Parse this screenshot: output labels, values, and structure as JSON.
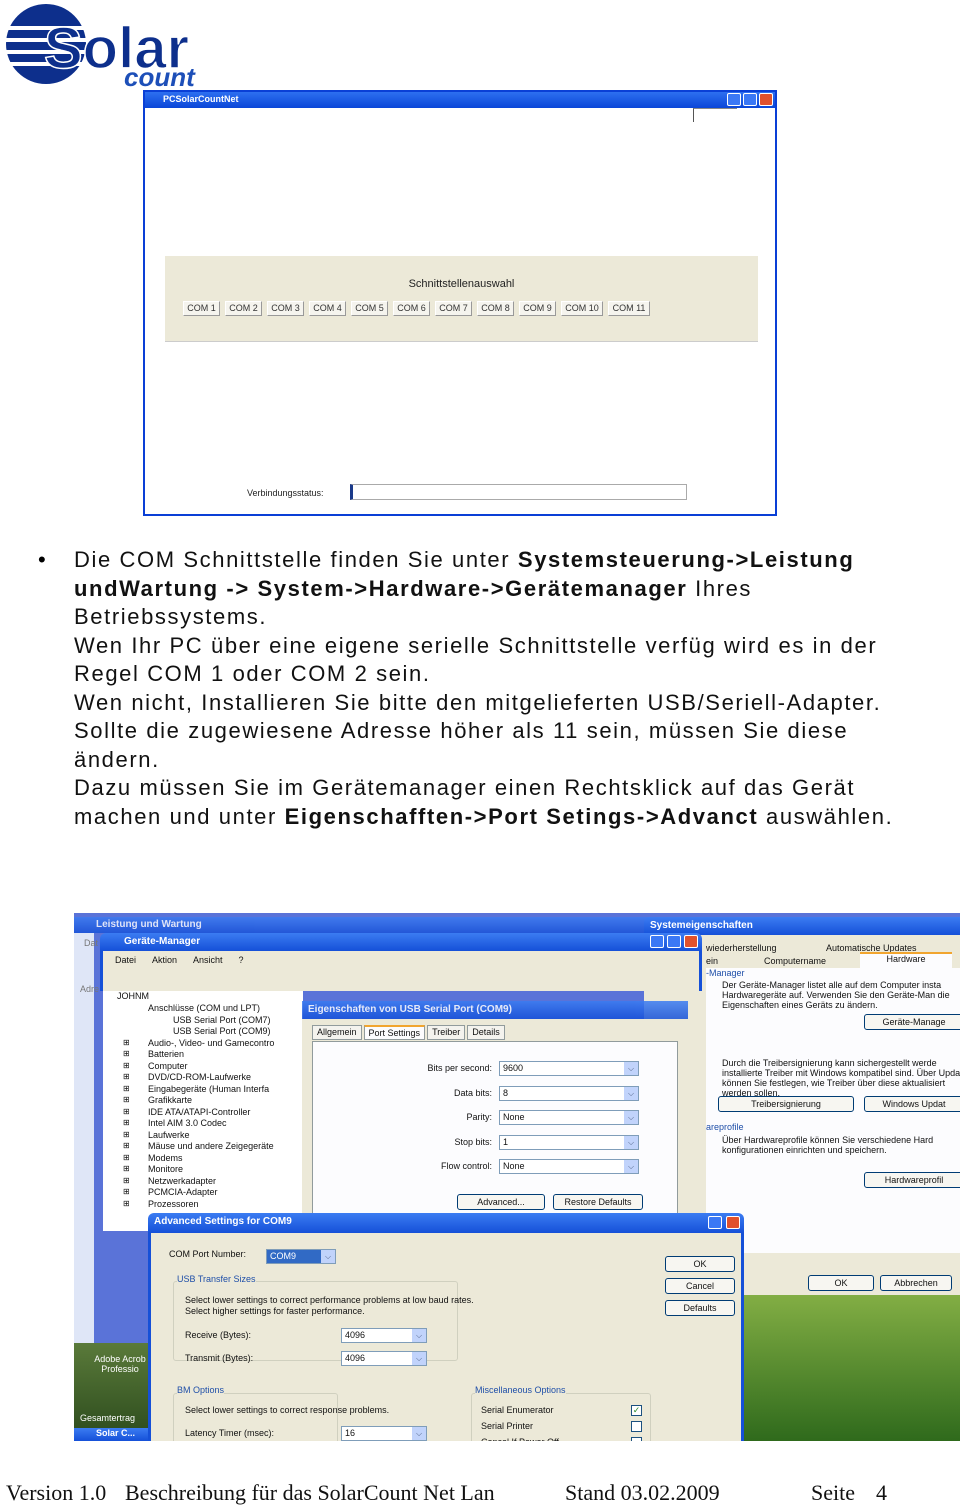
{
  "logo": {
    "text_main": "Solar",
    "text_sub": "count",
    "colors": {
      "blue": "#0d2f8c"
    }
  },
  "app_window": {
    "title": "PCSolarCountNet",
    "panel_title": "Schnittstellenauswahl",
    "com_buttons": [
      "COM 1",
      "COM 2",
      "COM 3",
      "COM 4",
      "COM 5",
      "COM 6",
      "COM 7",
      "COM 8",
      "COM 9",
      "COM 10",
      "COM 11"
    ],
    "status_label": "Verbindungsstatus:",
    "status_value": ""
  },
  "body": {
    "p1_a": "Die COM Schnittstelle finden Sie unter ",
    "p1_b": "Systemsteuerung->Leistung undWartung -> System->Hardware->Gerätemanager",
    "p1_c": " Ihres Betriebssystems.",
    "p2": "Wen Ihr PC über eine eigene serielle Schnittstelle verfüg wird es in der Regel COM 1 oder COM 2 sein.",
    "p3": "Wen nicht, Installieren Sie bitte den mitgelieferten USB/Seriell-Adapter.",
    "p4": "Sollte die zugewiesene Adresse höher als 11 sein, müssen Sie diese ändern.",
    "p5_a": "Dazu müssen Sie im Gerätemanager einen Rechtsklick auf das Gerät machen und unter ",
    "p5_b": "Eigenschafften->Port Setings->Advanct",
    "p5_c": " auswählen."
  },
  "screenshot": {
    "bg_window_title": "Leistung und Wartung",
    "sys_title": "Systemeigenschaften",
    "sys_tabs_row1": [
      "wiederherstellung",
      "Automatische Updates"
    ],
    "sys_tabs_row2": [
      "ein",
      "Computername",
      "Hardware"
    ],
    "sys_group1": "-Manager",
    "sys_text1": "Der Geräte-Manager listet alle auf dem Computer insta Hardwaregeräte auf. Verwenden Sie den Geräte-Man die Eigenschaften eines Geräts zu ändern.",
    "sys_btn1": "Geräte-Manage",
    "sys_text2": "Durch die Treibersignierung kann sichergestellt werde installierte Treiber mit Windows kompatibel sind. Über Update können Sie festlegen, wie Treiber über diese aktualisiert werden sollen.",
    "sys_btn2": "Treibersignierung",
    "sys_btn3": "Windows Updat",
    "sys_group3": "areprofile",
    "sys_text3": "Über Hardwareprofile können Sie verschiedene Hard konfigurationen einrichten und speichern.",
    "sys_btn4": "Hardwareprofil",
    "sys_ok": "OK",
    "sys_cancel": "Abbrechen",
    "dm_title": "Geräte-Manager",
    "dm_menu": [
      "Datei",
      "Aktion",
      "Ansicht",
      "?"
    ],
    "dm_tree_root": "JOHNM",
    "dm_tree": [
      "Anschlüsse (COM und LPT)",
      "USB Serial Port (COM7)",
      "USB Serial Port (COM9)",
      "Audio-, Video- und Gamecontro",
      "Batterien",
      "Computer",
      "DVD/CD-ROM-Laufwerke",
      "Eingabegeräte (Human Interfa",
      "Grafikkarte",
      "IDE ATA/ATAPI-Controller",
      "Intel AIM 3.0 Codec",
      "Laufwerke",
      "Mäuse und andere Zeigegeräte",
      "Modems",
      "Monitore",
      "Netzwerkadapter",
      "PCMCIA-Adapter",
      "Prozessoren"
    ],
    "left_fragments": {
      "dat": "Dat",
      "adr": "Adre"
    },
    "prop_title": "Eigenschaften von USB Serial Port (COM9)",
    "prop_tabs": [
      "Allgemein",
      "Port Settings",
      "Treiber",
      "Details"
    ],
    "prop_fields": [
      {
        "label": "Bits per second:",
        "value": "9600"
      },
      {
        "label": "Data bits:",
        "value": "8"
      },
      {
        "label": "Parity:",
        "value": "None"
      },
      {
        "label": "Stop bits:",
        "value": "1"
      },
      {
        "label": "Flow control:",
        "value": "None"
      }
    ],
    "prop_advanced": "Advanced...",
    "prop_restore": "Restore Defaults",
    "adv_title": "Advanced Settings for COM9",
    "adv_port_label": "COM Port Number:",
    "adv_port_value": "COM9",
    "adv_usb_group": "USB Transfer Sizes",
    "adv_usb_text1": "Select lower settings to correct performance problems at low baud rates.",
    "adv_usb_text2": "Select higher settings for faster performance.",
    "adv_receive_label": "Receive (Bytes):",
    "adv_receive_value": "4096",
    "adv_transmit_label": "Transmit (Bytes):",
    "adv_transmit_value": "4096",
    "adv_bm_group": "BM Options",
    "adv_bm_text": "Select lower settings to correct response problems.",
    "adv_latency_label": "Latency Timer (msec):",
    "adv_latency_value": "16",
    "adv_misc_group": "Miscellaneous Options",
    "adv_misc": [
      {
        "label": "Serial Enumerator",
        "checked": true
      },
      {
        "label": "Serial Printer",
        "checked": false
      },
      {
        "label": "Cancel If Power Off",
        "checked": false
      }
    ],
    "adv_ok": "OK",
    "adv_cancel": "Cancel",
    "adv_defaults": "Defaults",
    "desktop_icons": [
      "Adobe Acrob Professio",
      "Gesamtertrag"
    ],
    "taskbar_item": "Solar C..."
  },
  "footer": {
    "version": "Version 1.0",
    "desc": "Beschreibung für das SolarCount Net Lan",
    "date": "Stand 03.02.2009",
    "page_label": "Seite",
    "page_num": "4"
  }
}
